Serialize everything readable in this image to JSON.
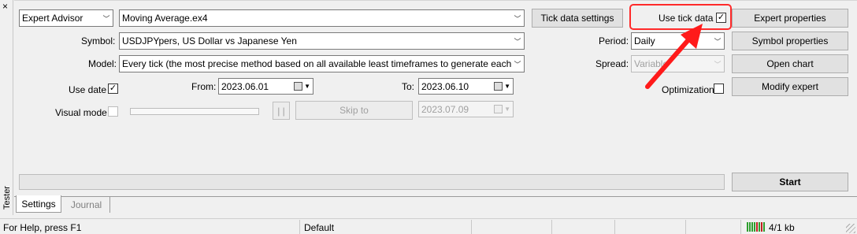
{
  "side_panel": {
    "close_glyph": "×",
    "title": "Tester"
  },
  "expert": {
    "type_value": "Expert Advisor",
    "file_value": "Moving Average.ex4"
  },
  "buttons": {
    "tick_data_settings": "Tick data settings",
    "expert_properties": "Expert properties",
    "symbol_properties": "Symbol properties",
    "open_chart": "Open chart",
    "modify_expert": "Modify expert",
    "skip_to": "Skip to",
    "start": "Start",
    "pause": "| |"
  },
  "use_tick_data": {
    "label": "Use tick data",
    "checked_glyph": "✓"
  },
  "symbol": {
    "label": "Symbol:",
    "value": "USDJPYpers, US Dollar vs Japanese Yen"
  },
  "model": {
    "label": "Model:",
    "value": "Every tick (the most precise method based on all available least timeframes to generate each ti"
  },
  "period": {
    "label": "Period:",
    "value": "Daily"
  },
  "spread": {
    "label": "Spread:",
    "value": "Variable"
  },
  "optimization": {
    "label": "Optimization"
  },
  "use_date": {
    "label": "Use date",
    "checked_glyph": "✓"
  },
  "from": {
    "label": "From:",
    "value": "2023.06.01"
  },
  "to": {
    "label": "To:",
    "value": "2023.06.10"
  },
  "visual_mode": {
    "label": "Visual mode",
    "skip_date": "2023.07.09"
  },
  "tabs": [
    {
      "label": "Settings"
    },
    {
      "label": "Journal"
    }
  ],
  "status": {
    "help": "For Help, press F1",
    "profile": "Default",
    "traffic": "4/1 kb"
  },
  "colors": {
    "highlight": "#ff2a2a",
    "arrow": "#ff1a1a",
    "meter_green": "#2e9e2e",
    "meter_red": "#c02020"
  }
}
